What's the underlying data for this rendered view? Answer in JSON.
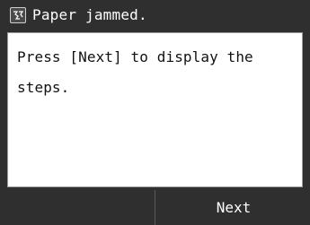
{
  "header": {
    "icon": "paper-jam-icon",
    "title": "Paper jammed."
  },
  "message": {
    "text": "Press [Next] to display the steps."
  },
  "footer": {
    "next_label": "Next"
  },
  "colors": {
    "background": "#2f2f2f",
    "panel": "#ffffff",
    "text": "#111111",
    "header_text": "#ffffff"
  }
}
